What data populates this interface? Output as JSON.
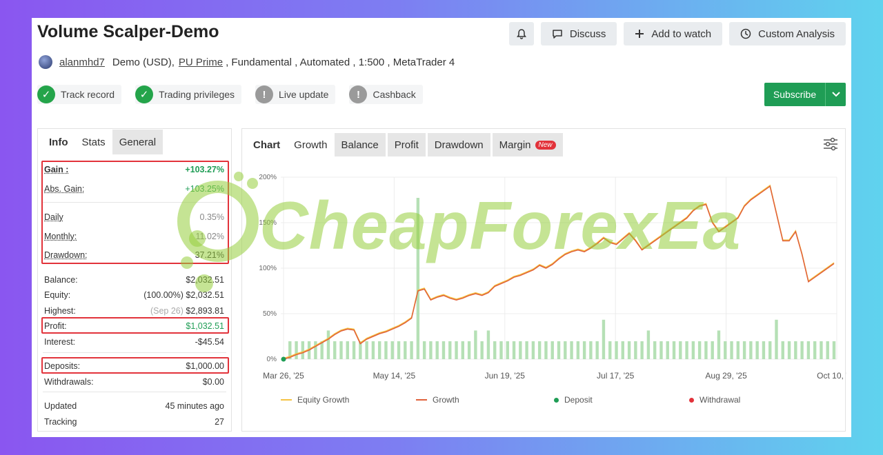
{
  "header": {
    "title": "Volume Scalper-Demo",
    "discuss_label": "Discuss",
    "watch_label": "Add to watch",
    "custom_label": "Custom Analysis"
  },
  "account": {
    "user": "alanmhd7",
    "type": "Demo (USD),",
    "broker": "PU Prime",
    "details": ", Fundamental , Automated , 1:500 , MetaTrader 4"
  },
  "badges": [
    {
      "label": "Track record",
      "ok": true
    },
    {
      "label": "Trading privileges",
      "ok": true
    },
    {
      "label": "Live update",
      "ok": false
    },
    {
      "label": "Cashback",
      "ok": false
    }
  ],
  "subscribe_label": "Subscribe",
  "info": {
    "tabs": [
      "Info",
      "Stats",
      "General"
    ],
    "gain_label": "Gain :",
    "gain_value": "+103.27%",
    "absgain_label": "Abs. Gain:",
    "absgain_value": "+103.25%",
    "daily_label": "Daily",
    "daily_value": "0.35%",
    "monthly_label": "Monthly:",
    "monthly_value": "11.02%",
    "drawdown_label": "Drawdown:",
    "drawdown_value": "37.21%",
    "balance_label": "Balance:",
    "balance_value": "$2,032.51",
    "equity_label": "Equity:",
    "equity_pct": "(100.00%)",
    "equity_value": "$2,032.51",
    "highest_label": "Highest:",
    "highest_date": "(Sep 26)",
    "highest_value": "$2,893.81",
    "profit_label": "Profit:",
    "profit_value": "$1,032.51",
    "interest_label": "Interest:",
    "interest_value": "-$45.54",
    "deposits_label": "Deposits:",
    "deposits_value": "$1,000.00",
    "withdrawals_label": "Withdrawals:",
    "withdrawals_value": "$0.00",
    "updated_label": "Updated",
    "updated_value": "45 minutes ago",
    "tracking_label": "Tracking",
    "tracking_value": "27"
  },
  "chart_tabs": {
    "head": "Chart",
    "tabs": [
      "Growth",
      "Balance",
      "Profit",
      "Drawdown",
      "Margin"
    ],
    "new_badge": "New"
  },
  "watermark": "CheapForexEa",
  "colors": {
    "green": "#1f9d55",
    "red_box": "#e2323a",
    "growth": "#e0603a",
    "equity": "#f5c242",
    "bar": "#b5e0b5"
  },
  "chart_data": {
    "type": "line",
    "x_ticks": [
      "Mar 26, '25",
      "May 14, '25",
      "Jun 19, '25",
      "Jul 17, '25",
      "Aug 29, '25",
      "Oct 10, '25"
    ],
    "y_ticks": [
      "0%",
      "50%",
      "100%",
      "150%",
      "200%"
    ],
    "ylim": [
      0,
      200
    ],
    "series": [
      {
        "name": "Equity Growth",
        "color": "#f5c242"
      },
      {
        "name": "Growth",
        "color": "#e0603a",
        "values": [
          0,
          2,
          5,
          7,
          10,
          14,
          18,
          22,
          27,
          31,
          33,
          32,
          17,
          22,
          25,
          28,
          30,
          33,
          36,
          40,
          45,
          75,
          77,
          65,
          68,
          70,
          67,
          65,
          67,
          70,
          72,
          70,
          73,
          80,
          83,
          86,
          90,
          92,
          95,
          98,
          103,
          100,
          104,
          110,
          115,
          118,
          120,
          118,
          122,
          127,
          133,
          128,
          126,
          132,
          138,
          130,
          120,
          125,
          130,
          135,
          140,
          145,
          150,
          155,
          163,
          168,
          170,
          150,
          140,
          145,
          150,
          155,
          168,
          175,
          180,
          185,
          190,
          160,
          130,
          130,
          140,
          115,
          85,
          90,
          95,
          100,
          105
        ]
      }
    ],
    "deposits": [
      {
        "x_index": 0,
        "value": 0
      }
    ],
    "legend": [
      "Equity Growth",
      "Growth",
      "Deposit",
      "Withdrawal"
    ],
    "grid": true
  }
}
